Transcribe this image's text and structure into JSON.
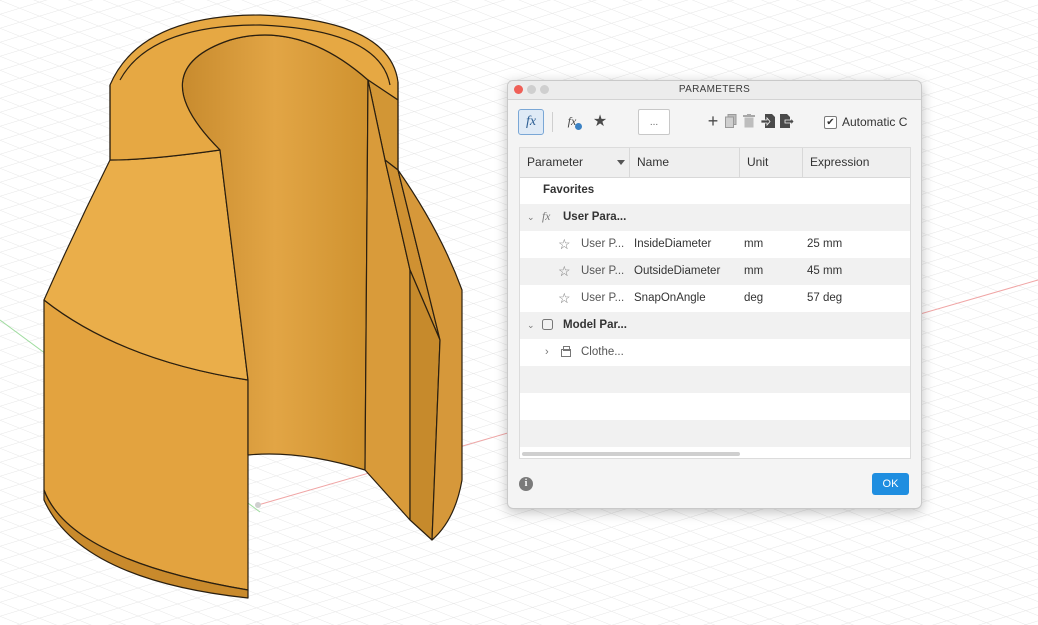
{
  "dialog": {
    "title": "PARAMETERS",
    "traffic_lights": [
      "#ef5f57",
      "#c9c9c9",
      "#c9c9c9"
    ],
    "toolbar": {
      "fx_icon": "fx",
      "user_fx_icon": "fx",
      "star_icon": "★",
      "search_placeholder": "...",
      "add_icon": "+",
      "automatic_label": "Automatic C",
      "automatic_checked": "✔"
    },
    "columns": [
      "Parameter",
      "Name",
      "Unit",
      "Expression"
    ],
    "rows": {
      "favorites": "Favorites",
      "user_group": "User Para...",
      "user_params": [
        {
          "param": "User P...",
          "name": "InsideDiameter",
          "unit": "mm",
          "expression": "25 mm"
        },
        {
          "param": "User P...",
          "name": "OutsideDiameter",
          "unit": "mm",
          "expression": "45 mm"
        },
        {
          "param": "User P...",
          "name": "SnapOnAngle",
          "unit": "deg",
          "expression": "57 deg"
        }
      ],
      "model_group": "Model Par...",
      "model_child": "Clothe..."
    },
    "info_icon": "i",
    "ok_label": "OK"
  },
  "colors": {
    "model_light": "#e9a944",
    "model_dark": "#c98a28",
    "accent": "#1f8ee0"
  }
}
